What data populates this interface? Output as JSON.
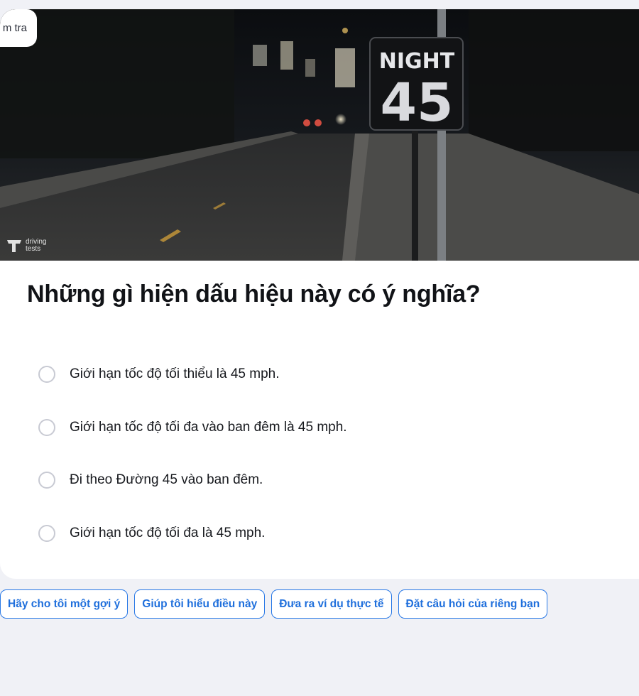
{
  "badge": {
    "text": "m tra"
  },
  "hero": {
    "sign_top": "NIGHT",
    "sign_number": "45",
    "watermark_line1": "driving",
    "watermark_line2": "tests"
  },
  "question": {
    "text": "Những gì hiện dấu hiệu này có ý nghĩa?"
  },
  "options": [
    {
      "label": "Giới hạn tốc độ tối thiểu là 45 mph.",
      "selected": false
    },
    {
      "label": "Giới hạn tốc độ tối đa vào ban đêm là 45 mph.",
      "selected": false
    },
    {
      "label": "Đi theo Đường 45 vào ban đêm.",
      "selected": false
    },
    {
      "label": "Giới hạn tốc độ tối đa là 45 mph.",
      "selected": false
    }
  ],
  "help_chips": [
    {
      "label": "Hãy cho tôi một gợi ý"
    },
    {
      "label": "Giúp tôi hiểu điều này"
    },
    {
      "label": "Đưa ra ví dụ thực tế"
    },
    {
      "label": "Đặt câu hỏi của riêng bạn"
    }
  ],
  "colors": {
    "accent": "#2878e6",
    "background": "#f0f1f6",
    "radio_border": "#c8cad3"
  }
}
